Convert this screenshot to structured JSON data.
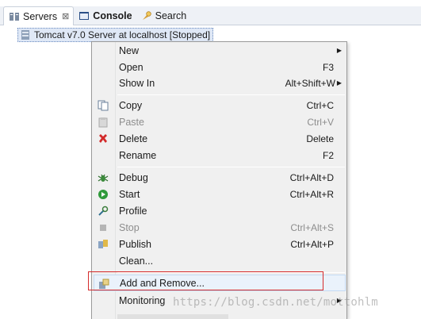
{
  "tabs": [
    {
      "label": "Servers",
      "icon": "servers-icon",
      "close": "⊠"
    },
    {
      "label": "Console",
      "icon": "console-icon"
    },
    {
      "label": "Search",
      "icon": "search-icon"
    }
  ],
  "server": {
    "label": "Tomcat v7.0 Server at localhost  [Stopped]"
  },
  "menu": {
    "items": [
      {
        "label": "New",
        "shortcut": "",
        "submenu": true
      },
      {
        "label": "Open",
        "shortcut": "F3"
      },
      {
        "label": "Show In",
        "shortcut": "Alt+Shift+W",
        "submenu": true
      },
      {
        "label": "Copy",
        "shortcut": "Ctrl+C",
        "icon": "copy-icon"
      },
      {
        "label": "Paste",
        "shortcut": "Ctrl+V",
        "icon": "paste-icon",
        "disabled": true
      },
      {
        "label": "Delete",
        "shortcut": "Delete",
        "icon": "delete-icon"
      },
      {
        "label": "Rename",
        "shortcut": "F2"
      },
      {
        "label": "Debug",
        "shortcut": "Ctrl+Alt+D",
        "icon": "debug-icon"
      },
      {
        "label": "Start",
        "shortcut": "Ctrl+Alt+R",
        "icon": "start-icon"
      },
      {
        "label": "Profile",
        "shortcut": "",
        "icon": "profile-icon"
      },
      {
        "label": "Stop",
        "shortcut": "Ctrl+Alt+S",
        "icon": "stop-icon",
        "disabled": true
      },
      {
        "label": "Publish",
        "shortcut": "Ctrl+Alt+P",
        "icon": "publish-icon"
      },
      {
        "label": "Clean...",
        "shortcut": ""
      },
      {
        "label": "Add and Remove...",
        "shortcut": "",
        "icon": "add-remove-icon",
        "highlighted": true
      },
      {
        "label": "Monitoring",
        "shortcut": "",
        "submenu": true
      }
    ]
  },
  "watermark": "https://blog.csdn.net/mottohlm",
  "colors": {
    "highlight_border": "#d52b2b",
    "menu_bg": "#f0f0f0",
    "selection_bg": "#dfe8f6"
  }
}
